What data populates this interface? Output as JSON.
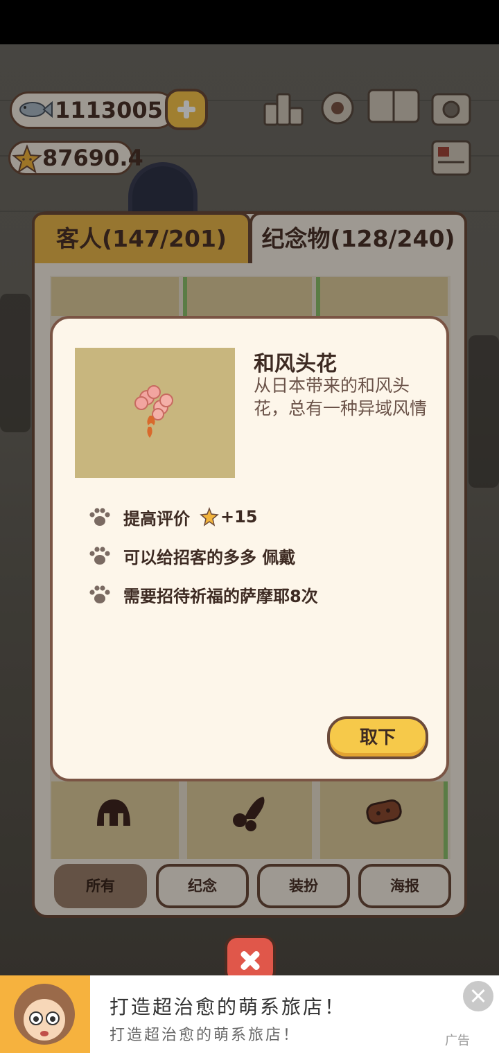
{
  "hud": {
    "fish_count": "1113005",
    "star_rating": "87690.4"
  },
  "tabs": [
    {
      "label": "客人(147/201)",
      "active": false
    },
    {
      "label": "纪念物(128/240)",
      "active": true
    }
  ],
  "filters": [
    {
      "label": "所有",
      "active": true
    },
    {
      "label": "纪念",
      "active": false
    },
    {
      "label": "装扮",
      "active": false
    },
    {
      "label": "海报",
      "active": false
    }
  ],
  "dialog": {
    "item_name": "和风头花",
    "description": "从日本带来的和风头花，总有一种异域风情",
    "attributes": [
      {
        "text": "提高评价",
        "bonus": "+15",
        "icon": "star-icon"
      },
      {
        "text": "可以给招客的多多 佩戴"
      },
      {
        "text": "需要招待祈福的萨摩耶8次"
      }
    ],
    "remove_label": "取下"
  },
  "ad": {
    "title": "打造超治愈的萌系旅店！",
    "subtitle": "打造超治愈的萌系旅店！",
    "label": "广告"
  },
  "colors": {
    "accent_yellow": "#f6c94a",
    "brown_border": "#6b4a3a",
    "panel_bg": "#f3ece1",
    "close_red": "#e0574a"
  }
}
